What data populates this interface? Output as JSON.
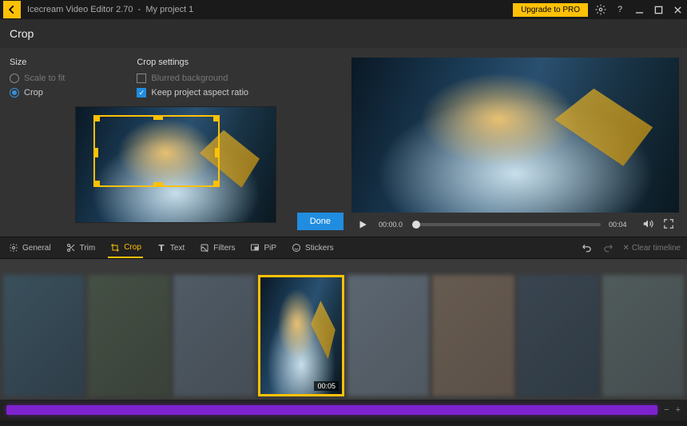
{
  "titlebar": {
    "app_name": "Icecream Video Editor 2.70",
    "project": "My project 1",
    "upgrade": "Upgrade to PRO"
  },
  "panel": {
    "title": "Crop"
  },
  "size_group": {
    "heading": "Size",
    "scale_to_fit": "Scale to fit",
    "crop": "Crop"
  },
  "crop_settings": {
    "heading": "Crop settings",
    "blurred_bg": "Blurred background",
    "keep_ratio": "Keep project aspect ratio"
  },
  "actions": {
    "done": "Done"
  },
  "playback": {
    "current": "00:00.0",
    "duration": "00:04"
  },
  "tools": {
    "general": "General",
    "trim": "Trim",
    "crop": "Crop",
    "text": "Text",
    "filters": "Filters",
    "pip": "PiP",
    "stickers": "Stickers",
    "clear": "Clear timeline"
  },
  "timeline": {
    "selected_clip_dur": "00:05"
  }
}
